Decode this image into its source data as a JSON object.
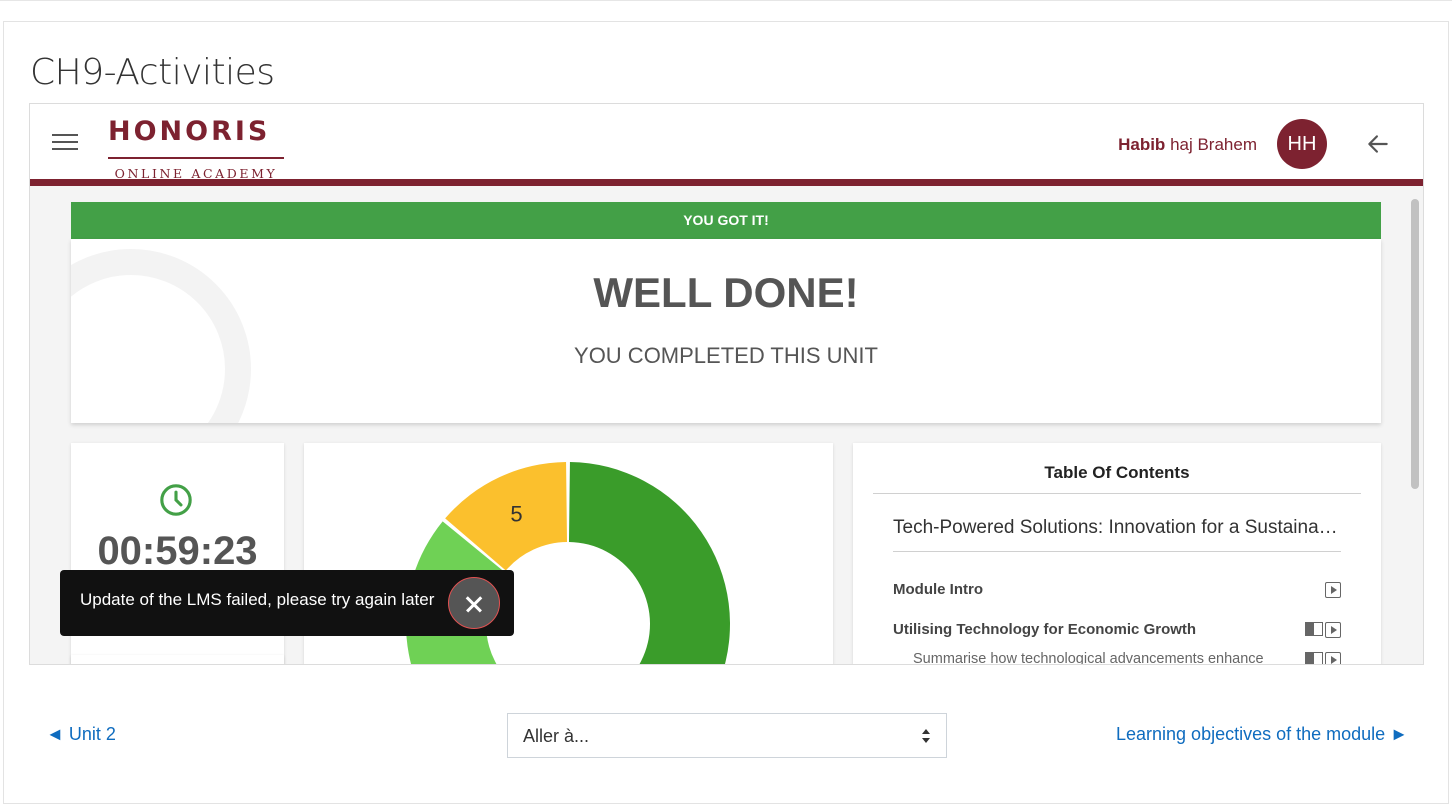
{
  "page": {
    "title": "CH9-Activities"
  },
  "header": {
    "logo": {
      "word": "HONORIS",
      "subtitle": "ONLINE ACADEMY"
    },
    "user": {
      "first": "Habib",
      "last": "haj Brahem",
      "initials": "HH"
    },
    "colors": {
      "brand": "#7d2230"
    },
    "icons": {
      "menu": "hamburger-menu-icon",
      "back": "arrow-left-icon"
    }
  },
  "result": {
    "banner": "YOU GOT IT!",
    "title": "WELL DONE!",
    "subtitle": "YOU COMPLETED THIS UNIT",
    "colors": {
      "banner": "#43a047"
    }
  },
  "timer": {
    "value": "00:59:23",
    "icon": "clock-icon"
  },
  "chart_data": {
    "type": "pie",
    "donut": true,
    "labels": [
      "",
      "",
      "5"
    ],
    "slices": [
      {
        "value": 22,
        "color": "#3a9c2a",
        "label": ""
      },
      {
        "value": 9,
        "color": "#6fd155",
        "label": ""
      },
      {
        "value": 5,
        "color": "#fbc02d",
        "label": "5"
      }
    ]
  },
  "toc": {
    "title": "Table Of Contents",
    "course": "Tech-Powered Solutions: Innovation for a Sustainable Future",
    "items": [
      {
        "label": "Module Intro",
        "bold": true,
        "icons": [
          "play"
        ]
      },
      {
        "label": "Utilising Technology for Economic Growth",
        "bold": true,
        "icons": [
          "book",
          "play"
        ]
      },
      {
        "label": "Summarise how technological advancements enhance",
        "bold": false,
        "icons": [
          "book",
          "play"
        ]
      }
    ]
  },
  "toast": {
    "message": "Update of the LMS failed, please try again later",
    "close_icon": "close-icon"
  },
  "navigation": {
    "prev": "◄ Unit 2",
    "jump_select": "Aller à...",
    "next": "Learning objectives of the module ►"
  }
}
